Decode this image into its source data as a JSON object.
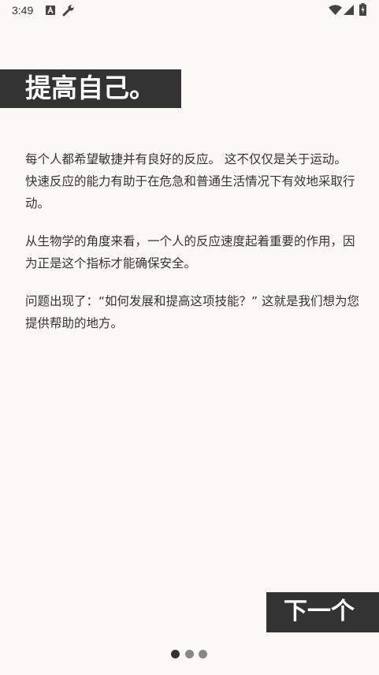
{
  "status_bar": {
    "time": "3:49",
    "icons": [
      "notification-a-icon",
      "wrench-icon",
      "wifi-icon",
      "cell-signal-icon",
      "battery-charging-icon"
    ]
  },
  "intro": {
    "title": "提高自己。",
    "paragraphs": [
      "每个人都希望敏捷并有良好的反应。 这不仅仅是关于运动。 快速反应的能力有助于在危急和普通生活情况下有效地采取行动。",
      "从生物学的角度来看，一个人的反应速度起着重要的作用，因为正是这个指标才能确保安全。",
      "问题出现了：“如何发展和提高这项技能？” 这就是我们想为您提供帮助的地方。"
    ]
  },
  "actions": {
    "next_label": "下一个"
  },
  "pager": {
    "count": 3,
    "active_index": 0
  },
  "colors": {
    "background": "#faf9f5",
    "dark": "#333333",
    "dot_inactive": "#888888"
  }
}
